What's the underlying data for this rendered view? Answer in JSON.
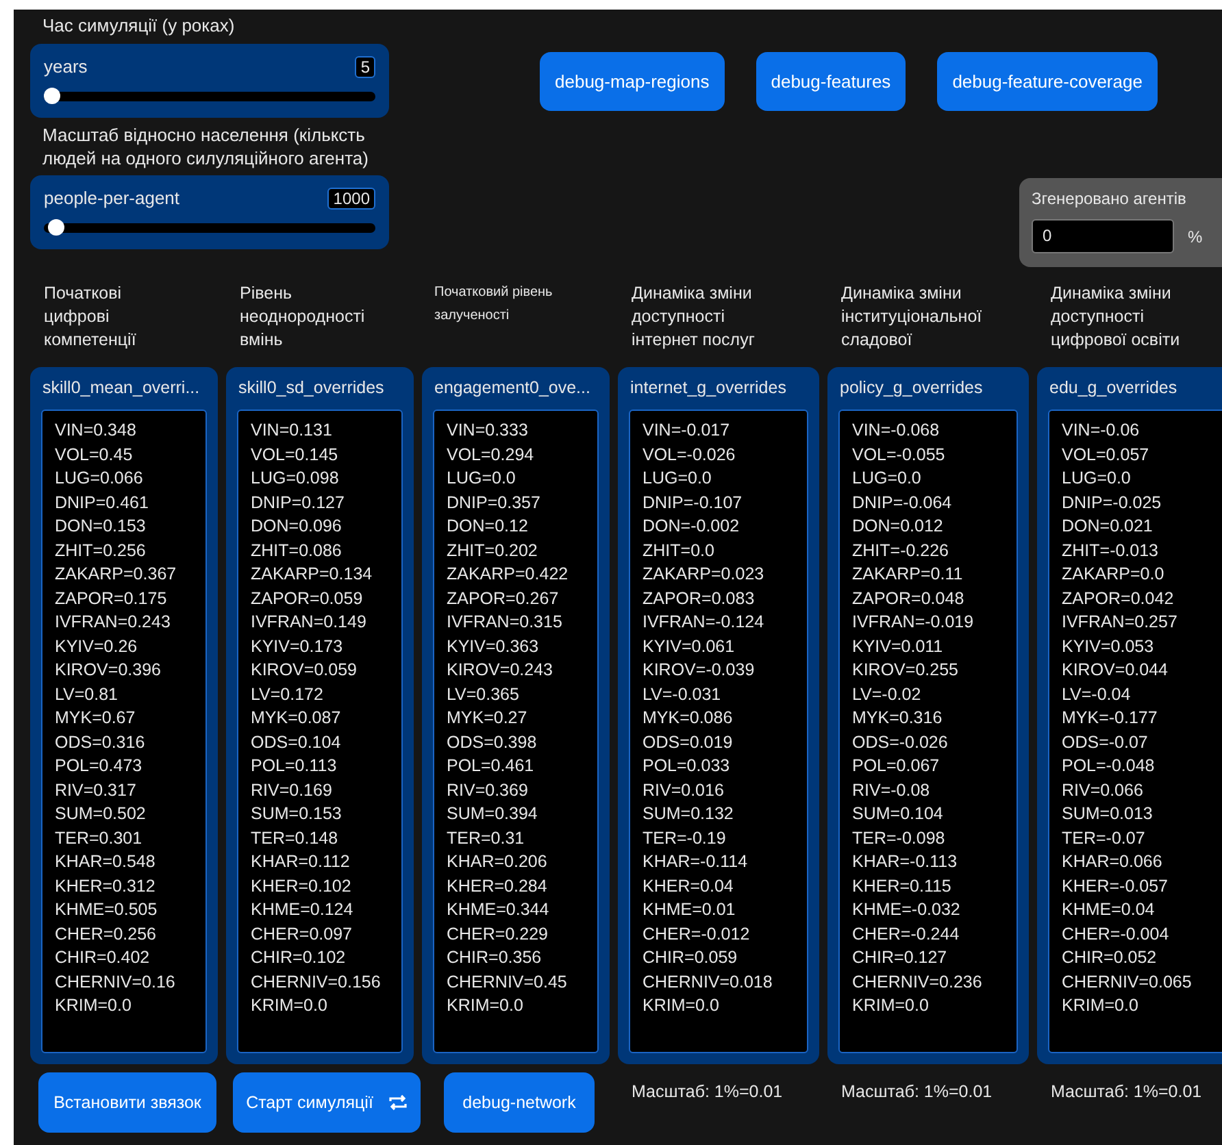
{
  "sliders": [
    {
      "caption": "Час симуляції (у роках)",
      "name": "years",
      "value": "5",
      "level": 0
    },
    {
      "caption": "Масштаб відносно населення (кільксть людей на одного силуляційного агента)",
      "name": "people-per-agent",
      "value": "1000",
      "level": 0.012
    }
  ],
  "top_buttons": [
    "debug-map-regions",
    "debug-features",
    "debug-feature-coverage"
  ],
  "monitor": {
    "label": "Згенеровано агентів",
    "value": "0",
    "unit": "%"
  },
  "columns": [
    {
      "label": "Початкові цифрові компетенції",
      "small": false,
      "name": "skill0_mean_overri...",
      "lines": [
        "VIN=0.348",
        "VOL=0.45",
        "LUG=0.066",
        "DNIP=0.461",
        "DON=0.153",
        "ZHIT=0.256",
        "ZAKARP=0.367",
        "ZAPOR=0.175",
        "IVFRAN=0.243",
        "KYIV=0.26",
        "KIROV=0.396",
        "LV=0.81",
        "MYK=0.67",
        "ODS=0.316",
        "POL=0.473",
        "RIV=0.317",
        "SUM=0.502",
        "TER=0.301",
        "KHAR=0.548",
        "KHER=0.312",
        "KHME=0.505",
        "CHER=0.256",
        "CHIR=0.402",
        "CHERNIV=0.16",
        "KRIM=0.0"
      ],
      "footer": {
        "kind": "button",
        "text": "Встановити звязок",
        "forever": false
      }
    },
    {
      "label": "Рівень неоднородності вмінь",
      "small": false,
      "name": "skill0_sd_overrides",
      "lines": [
        "VIN=0.131",
        "VOL=0.145",
        "LUG=0.098",
        "DNIP=0.127",
        "DON=0.096",
        "ZHIT=0.086",
        "ZAKARP=0.134",
        "ZAPOR=0.059",
        "IVFRAN=0.149",
        "KYIV=0.173",
        "KIROV=0.059",
        "LV=0.172",
        "MYK=0.087",
        "ODS=0.104",
        "POL=0.113",
        "RIV=0.169",
        "SUM=0.153",
        "TER=0.148",
        "KHAR=0.112",
        "KHER=0.102",
        "KHME=0.124",
        "CHER=0.097",
        "CHIR=0.102",
        "CHERNIV=0.156",
        "KRIM=0.0"
      ],
      "footer": {
        "kind": "button",
        "text": "Старт симуляції",
        "forever": true
      }
    },
    {
      "label": "Початковий рівень залученості",
      "small": true,
      "name": "engagement0_ove...",
      "lines": [
        "VIN=0.333",
        "VOL=0.294",
        "LUG=0.0",
        "DNIP=0.357",
        "DON=0.12",
        "ZHIT=0.202",
        "ZAKARP=0.422",
        "ZAPOR=0.267",
        "IVFRAN=0.315",
        "KYIV=0.363",
        "KIROV=0.243",
        "LV=0.365",
        "MYK=0.27",
        "ODS=0.398",
        "POL=0.461",
        "RIV=0.369",
        "SUM=0.394",
        "TER=0.31",
        "KHAR=0.206",
        "KHER=0.284",
        "KHME=0.344",
        "CHER=0.229",
        "CHIR=0.356",
        "CHERNIV=0.45",
        "KRIM=0.0"
      ],
      "footer": {
        "kind": "button",
        "text": "debug-network",
        "forever": false
      }
    },
    {
      "label": "Динаміка зміни доступності інтернет послуг",
      "small": false,
      "name": "internet_g_overrides",
      "lines": [
        "VIN=-0.017",
        "VOL=-0.026",
        "LUG=0.0",
        "DNIP=-0.107",
        "DON=-0.002",
        "ZHIT=0.0",
        "ZAKARP=0.023",
        "ZAPOR=0.083",
        "IVFRAN=-0.124",
        "KYIV=0.061",
        "KIROV=-0.039",
        "LV=-0.031",
        "MYK=0.086",
        "ODS=0.019",
        "POL=0.033",
        "RIV=0.016",
        "SUM=0.132",
        "TER=-0.19",
        "KHAR=-0.114",
        "KHER=0.04",
        "KHME=0.01",
        "CHER=-0.012",
        "CHIR=0.059",
        "CHERNIV=0.018",
        "KRIM=0.0"
      ],
      "footer": {
        "kind": "note",
        "text": "Масштаб: 1%=0.01"
      }
    },
    {
      "label": "Динаміка зміни інституціональної сладової",
      "small": false,
      "name": "policy_g_overrides",
      "lines": [
        "VIN=-0.068",
        "VOL=-0.055",
        "LUG=0.0",
        "DNIP=-0.064",
        "DON=0.012",
        "ZHIT=-0.226",
        "ZAKARP=0.11",
        "ZAPOR=0.048",
        "IVFRAN=-0.019",
        "KYIV=0.011",
        "KIROV=0.255",
        "LV=-0.02",
        "MYK=0.316",
        "ODS=-0.026",
        "POL=0.067",
        "RIV=-0.08",
        "SUM=0.104",
        "TER=-0.098",
        "KHAR=-0.113",
        "KHER=0.115",
        "KHME=-0.032",
        "CHER=-0.244",
        "CHIR=0.127",
        "CHERNIV=0.236",
        "KRIM=0.0"
      ],
      "footer": {
        "kind": "note",
        "text": "Масштаб: 1%=0.01"
      }
    },
    {
      "label": "Динаміка зміни доступності цифрової освіти",
      "small": false,
      "name": "edu_g_overrides",
      "lines": [
        "VIN=-0.06",
        "VOL=0.057",
        "LUG=0.0",
        "DNIP=-0.025",
        "DON=0.021",
        "ZHIT=-0.013",
        "ZAKARP=0.0",
        "ZAPOR=0.042",
        "IVFRAN=0.257",
        "KYIV=0.053",
        "KIROV=0.044",
        "LV=-0.04",
        "MYK=-0.177",
        "ODS=-0.07",
        "POL=-0.048",
        "RIV=0.066",
        "SUM=0.013",
        "TER=-0.07",
        "KHAR=0.066",
        "KHER=-0.057",
        "KHME=0.04",
        "CHER=-0.004",
        "CHIR=0.052",
        "CHERNIV=0.065",
        "KRIM=0.0"
      ],
      "footer": {
        "kind": "note",
        "text": "Масштаб: 1%=0.01"
      }
    }
  ]
}
